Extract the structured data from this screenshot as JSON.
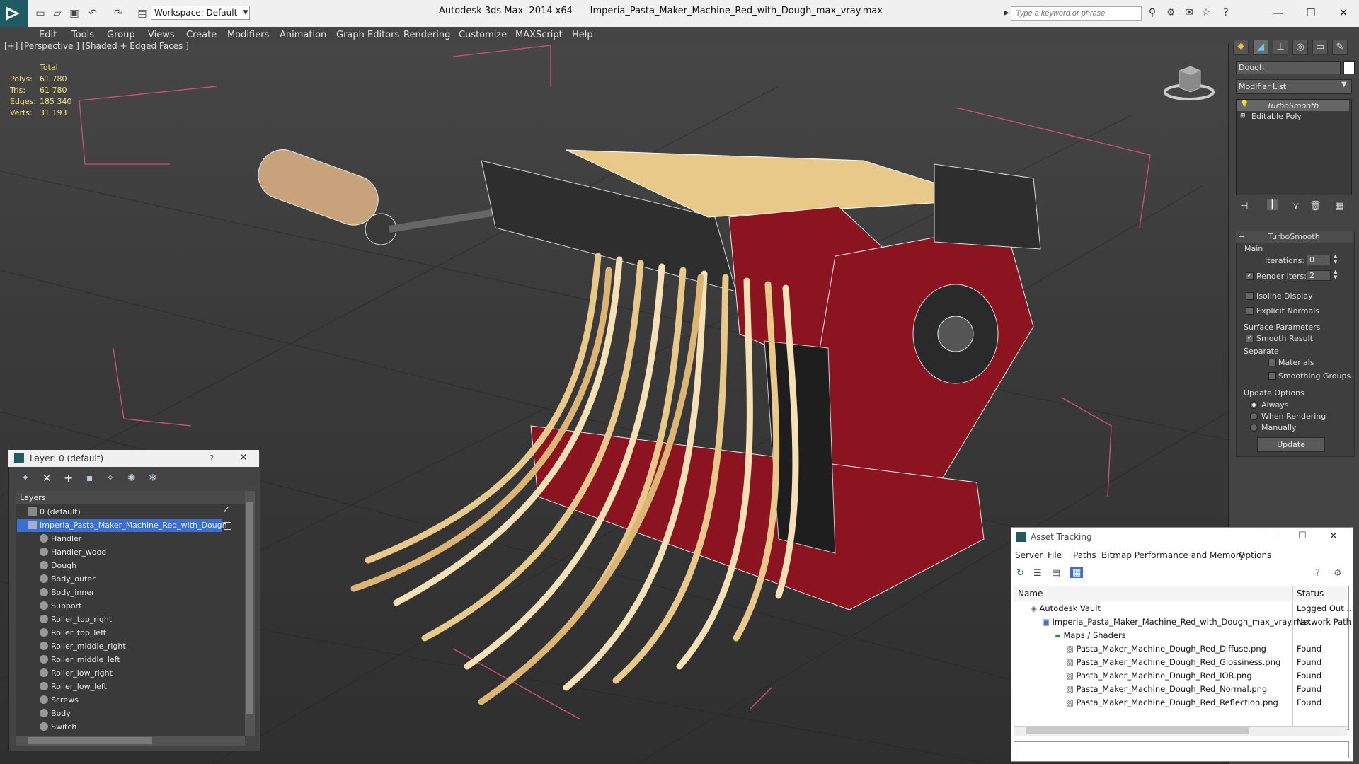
{
  "app": {
    "title": "Autodesk 3ds Max  2014 x64      Imperia_Pasta_Maker_Machine_Red_with_Dough_max_vray.max",
    "workspace": "Workspace: Default",
    "search_placeholder": "Type a keyword or phrase"
  },
  "menu": [
    "Edit",
    "Tools",
    "Group",
    "Views",
    "Create",
    "Modifiers",
    "Animation",
    "Graph Editors",
    "Rendering",
    "Customize",
    "MAXScript",
    "Help"
  ],
  "viewport": {
    "label": "[+] [Perspective ] [Shaded + Edged Faces ]",
    "stats": {
      "header": "Total",
      "rows": [
        {
          "label": "Polys:",
          "value": "61 780"
        },
        {
          "label": "Tris:",
          "value": "61 780"
        },
        {
          "label": "Edges:",
          "value": "185 340"
        },
        {
          "label": "Verts:",
          "value": "31 193"
        }
      ]
    }
  },
  "command_panel": {
    "object_name": "Dough",
    "modifier_list": "Modifier List",
    "stack": [
      "TurboSmooth",
      "Editable Poly"
    ],
    "rollout_title": "TurboSmooth",
    "main_label": "Main",
    "iterations_label": "Iterations:",
    "iterations_value": "0",
    "render_iters_label": "Render Iters:",
    "render_iters_value": "2",
    "isoline": "Isoline Display",
    "explicit": "Explicit Normals",
    "surface_params": "Surface Parameters",
    "smooth_result": "Smooth Result",
    "separate": "Separate",
    "materials": "Materials",
    "smoothing_groups": "Smoothing Groups",
    "update_options": "Update Options",
    "always": "Always",
    "when_rendering": "When Rendering",
    "manually": "Manually",
    "update_btn": "Update"
  },
  "layer_window": {
    "title": "Layer: 0 (default)",
    "help": "?",
    "column": "Layers",
    "layers": [
      {
        "name": "0 (default)",
        "level": 0
      },
      {
        "name": "Imperia_Pasta_Maker_Machine_Red_with_Dough",
        "level": 0,
        "selected": true
      },
      {
        "name": "Handler",
        "level": 1
      },
      {
        "name": "Handler_wood",
        "level": 1
      },
      {
        "name": "Dough",
        "level": 1
      },
      {
        "name": "Body_outer",
        "level": 1
      },
      {
        "name": "Body_inner",
        "level": 1
      },
      {
        "name": "Support",
        "level": 1
      },
      {
        "name": "Roller_top_right",
        "level": 1
      },
      {
        "name": "Roller_top_left",
        "level": 1
      },
      {
        "name": "Roller_middle_right",
        "level": 1
      },
      {
        "name": "Roller_middle_left",
        "level": 1
      },
      {
        "name": "Roller_low_right",
        "level": 1
      },
      {
        "name": "Roller_low_left",
        "level": 1
      },
      {
        "name": "Screws",
        "level": 1
      },
      {
        "name": "Body",
        "level": 1
      },
      {
        "name": "Switch",
        "level": 1
      }
    ]
  },
  "asset_window": {
    "title": "Asset Tracking",
    "menu": [
      "Server",
      "File",
      "Paths",
      "Bitmap Performance and Memory",
      "Options"
    ],
    "col_name": "Name",
    "col_status": "Status",
    "rows": [
      {
        "name": "Autodesk Vault",
        "status": "Logged Out ...",
        "indent": 1
      },
      {
        "name": "Imperia_Pasta_Maker_Machine_Red_with_Dough_max_vray.max",
        "status": "Network Path",
        "indent": 2
      },
      {
        "name": "Maps / Shaders",
        "status": "",
        "indent": 3
      },
      {
        "name": "Pasta_Maker_Machine_Dough_Red_Diffuse.png",
        "status": "Found",
        "indent": 4
      },
      {
        "name": "Pasta_Maker_Machine_Dough_Red_Glossiness.png",
        "status": "Found",
        "indent": 4
      },
      {
        "name": "Pasta_Maker_Machine_Dough_Red_IOR.png",
        "status": "Found",
        "indent": 4
      },
      {
        "name": "Pasta_Maker_Machine_Dough_Red_Normal.png",
        "status": "Found",
        "indent": 4
      },
      {
        "name": "Pasta_Maker_Machine_Dough_Red_Reflection.png",
        "status": "Found",
        "indent": 4
      }
    ]
  },
  "colors": {
    "machine_red": "#8b1420",
    "dough": "#e8c98a",
    "roller_black": "#2a2a2a",
    "handle_wood": "#c8a27a",
    "selection": "#3a6fd0"
  }
}
